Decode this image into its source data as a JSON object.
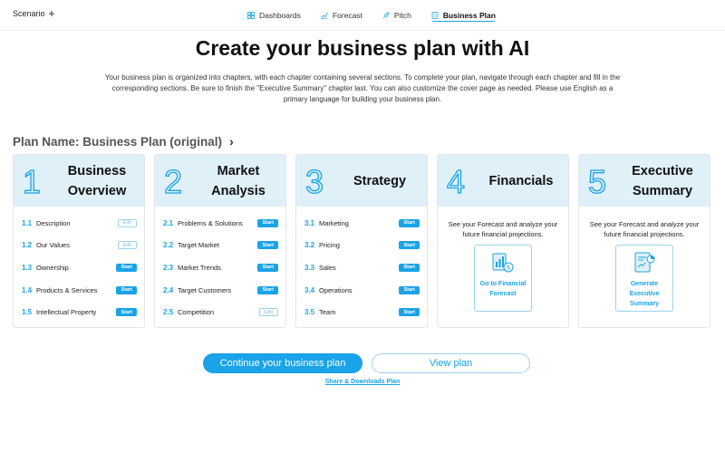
{
  "topbar": {
    "scenario_label": "Scenario",
    "scenario_add": "+",
    "tabs": [
      {
        "label": "Dashboards",
        "icon": "dashboard-icon"
      },
      {
        "label": "Forecast",
        "icon": "chart-line-icon"
      },
      {
        "label": "Pitch",
        "icon": "rocket-icon"
      },
      {
        "label": "Business Plan",
        "icon": "document-icon",
        "active": true
      }
    ]
  },
  "main": {
    "title": "Create your business plan with AI",
    "intro": "Your business plan is organized into chapters, with each chapter containing several sections. To complete your plan, navigate through each chapter and fill in the corresponding sections. Be sure to finish the \"Executive Summary\" chapter last. You can also customize the cover page as needed. Please use English as a primary language for building your business plan.",
    "plan_name": "Plan Name: Business Plan (original)",
    "plan_chevron": "›"
  },
  "chapters": [
    {
      "num": "1",
      "title_line1": "Business",
      "title_line2": "Overview",
      "sections": [
        {
          "idx": "1.1",
          "label": "Description",
          "badge": "Edit"
        },
        {
          "idx": "1.2",
          "label": "Our Values",
          "badge": "Edit"
        },
        {
          "idx": "1.3",
          "label": "Ownership",
          "badge": "Start"
        },
        {
          "idx": "1.4",
          "label": "Products & Services",
          "badge": "Start"
        },
        {
          "idx": "1.5",
          "label": "Intellectual Property",
          "badge": "Start"
        }
      ]
    },
    {
      "num": "2",
      "title_line1": "Market",
      "title_line2": "Analysis",
      "sections": [
        {
          "idx": "2.1",
          "label": "Problems & Solutions",
          "badge": "Start"
        },
        {
          "idx": "2.2",
          "label": "Target Market",
          "badge": "Start"
        },
        {
          "idx": "2.3",
          "label": "Market Trends",
          "badge": "Start"
        },
        {
          "idx": "2.4",
          "label": "Target Customers",
          "badge": "Start"
        },
        {
          "idx": "2.5",
          "label": "Competition",
          "badge": "Edit"
        }
      ]
    },
    {
      "num": "3",
      "title_line1": "Strategy",
      "title_line2": "",
      "sections": [
        {
          "idx": "3.1",
          "label": "Marketing",
          "badge": "Start"
        },
        {
          "idx": "3.2",
          "label": "Pricing",
          "badge": "Start"
        },
        {
          "idx": "3.3",
          "label": "Sales",
          "badge": "Start"
        },
        {
          "idx": "3.4",
          "label": "Operations",
          "badge": "Start"
        },
        {
          "idx": "3.5",
          "label": "Team",
          "badge": "Start"
        }
      ]
    },
    {
      "num": "4",
      "title_line1": "Financials",
      "title_line2": "",
      "desc": "See your Forecast and analyze your future financial projections.",
      "action": "Go to Financial Forecast"
    },
    {
      "num": "5",
      "title_line1": "Executive",
      "title_line2": "Summary",
      "desc": "See your Forecast and analyze your future financial projections.",
      "action": "Generate Executive Summary"
    }
  ],
  "actions": {
    "continue": "Continue your business plan",
    "view": "View plan",
    "share": "Share & Downloads Plan"
  },
  "colors": {
    "accent": "#1aa3e8",
    "card_header": "#dff0f9"
  }
}
